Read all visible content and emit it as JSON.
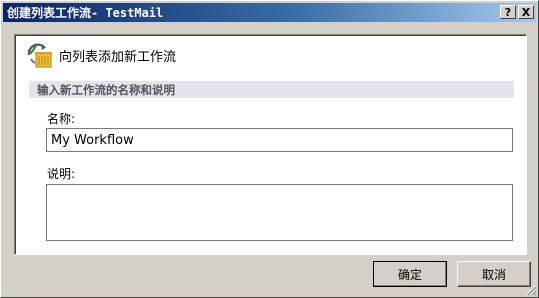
{
  "window": {
    "title": "创建列表工作流- TestMail",
    "help_button": "?",
    "close_button": "X"
  },
  "header": {
    "icon": "workflow-icon",
    "text": "向列表添加新工作流"
  },
  "section": {
    "title": "输入新工作流的名称和说明"
  },
  "form": {
    "name_label": "名称:",
    "name_value": "My Workflow",
    "description_label": "说明:",
    "description_value": ""
  },
  "buttons": {
    "ok": "确定",
    "cancel": "取消"
  },
  "colors": {
    "titlebar_start": "#0a246a",
    "titlebar_end": "#a6caf0",
    "dialog_bg": "#d4d0c8",
    "section_bar": "#e4e4ec"
  }
}
